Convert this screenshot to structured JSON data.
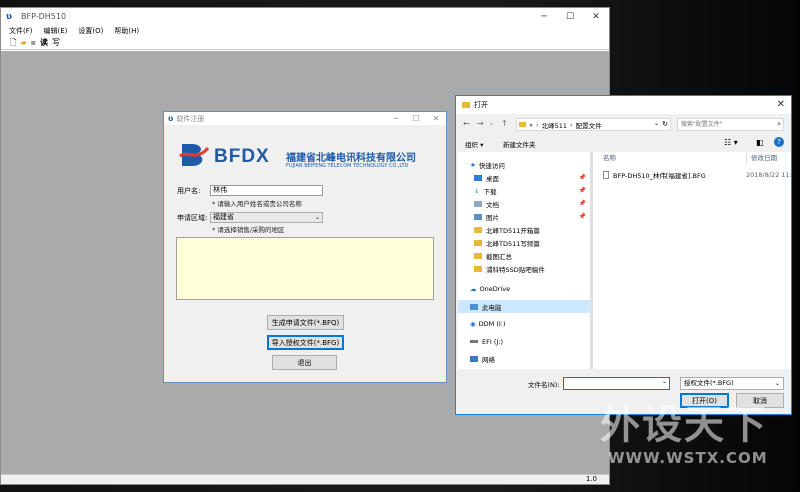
{
  "main_window": {
    "title": "BFP-DH510",
    "menu": [
      "文件(F)",
      "编辑(E)",
      "设置(O)",
      "帮助(H)"
    ],
    "toolbar_text": [
      "读",
      "写"
    ],
    "version": "1.0"
  },
  "register_dialog": {
    "title": "软件注册",
    "brand_name": "BFDX",
    "company_cn": "福建省北峰电讯科技有限公司",
    "company_en": "FUJIAN BEIFENG TELECOM TECHNOLOGY CO.,LTD",
    "username_label": "用户名:",
    "username_value": "林伟",
    "username_hint": "* 请输入用户姓名或贵公司名称",
    "region_label": "申请区域:",
    "region_value": "福建省",
    "region_hint": "* 请选择销售/采购的地区",
    "btn_generate": "生成申请文件(*.BFQ)",
    "btn_import": "导入授权文件(*.BFG)",
    "btn_exit": "退出"
  },
  "open_dialog": {
    "title": "打开",
    "path": [
      "«",
      "北峰511",
      "配置文件"
    ],
    "search_placeholder": "搜索\"配置文件\"",
    "organize": "组织 ▾",
    "new_folder": "新建文件夹",
    "nav_items": [
      {
        "label": "快速访问",
        "icon": "star-icon",
        "pinned": false
      },
      {
        "label": "桌面",
        "icon": "desktop-icon",
        "pinned": true
      },
      {
        "label": "下载",
        "icon": "download-icon",
        "pinned": true
      },
      {
        "label": "文档",
        "icon": "document-icon",
        "pinned": true
      },
      {
        "label": "图片",
        "icon": "picture-icon",
        "pinned": true
      },
      {
        "label": "北峰TD511开箱篇",
        "icon": "folder-icon",
        "pinned": false
      },
      {
        "label": "北峰TD511写频篇",
        "icon": "folder-icon",
        "pinned": false
      },
      {
        "label": "截图汇总",
        "icon": "folder-icon",
        "pinned": false
      },
      {
        "label": "浦科特SSD贴吧稿件",
        "icon": "folder-icon",
        "pinned": false
      },
      {
        "label": "OneDrive",
        "icon": "cloud-icon",
        "pinned": false
      },
      {
        "label": "此电脑",
        "icon": "computer-icon",
        "pinned": false
      },
      {
        "label": "DDM (I:)",
        "icon": "drive-icon",
        "pinned": false
      },
      {
        "label": "EFI (J:)",
        "icon": "drive-icon",
        "pinned": false
      },
      {
        "label": "网络",
        "icon": "network-icon",
        "pinned": false
      }
    ],
    "col_name": "名称",
    "col_date": "修改日期",
    "files": [
      {
        "name": "BFP-DH510_林伟[福建省].BFG",
        "date": "2018/8/22 11:"
      }
    ],
    "filename_label": "文件名(N):",
    "filename_value": "",
    "filetype": "授权文件(*.BFG)",
    "btn_open": "打开(O)",
    "btn_cancel": "取消"
  },
  "watermark": {
    "text": "外设天下",
    "url": "WWW.WSTX.COM"
  },
  "colors": {
    "brand": "#1e5aa8",
    "memo_bg": "#ffffd9",
    "client_bg": "#abaaaa",
    "accent": "#0078d7"
  }
}
